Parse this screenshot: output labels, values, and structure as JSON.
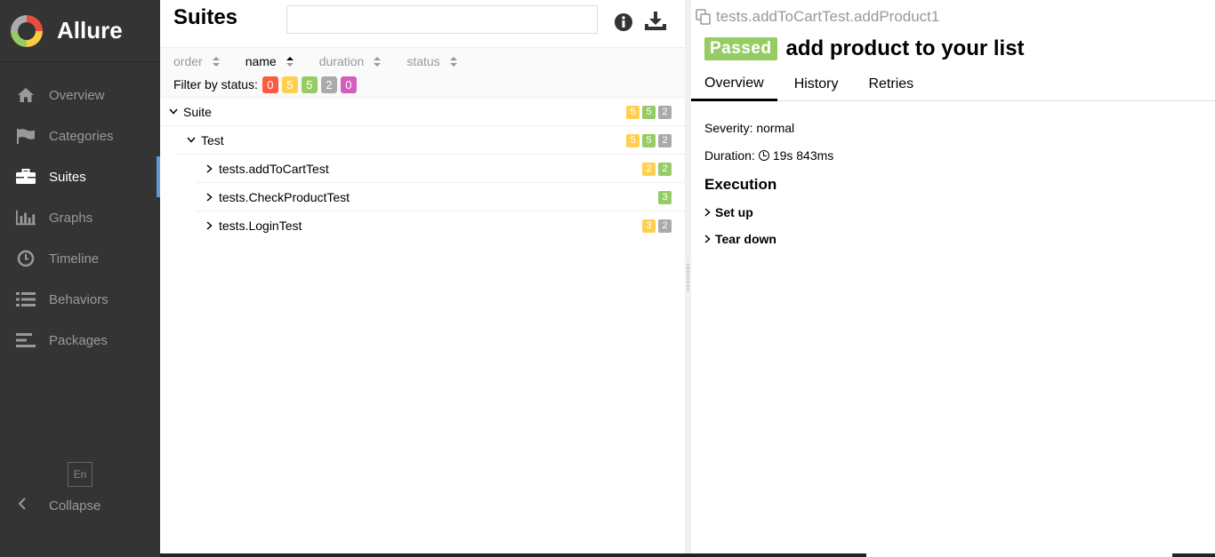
{
  "sidebar": {
    "brand": "Allure",
    "items": [
      {
        "label": "Overview"
      },
      {
        "label": "Categories"
      },
      {
        "label": "Suites"
      },
      {
        "label": "Graphs"
      },
      {
        "label": "Timeline"
      },
      {
        "label": "Behaviors"
      },
      {
        "label": "Packages"
      }
    ],
    "language": "En",
    "collapse_label": "Collapse"
  },
  "middle": {
    "title": "Suites",
    "search": {
      "value": "",
      "placeholder": ""
    },
    "sorters": [
      {
        "label": "order"
      },
      {
        "label": "name"
      },
      {
        "label": "duration"
      },
      {
        "label": "status"
      }
    ],
    "filter_label": "Filter by status:",
    "filter_counts": {
      "failed": "0",
      "broken": "5",
      "passed": "5",
      "skipped": "2",
      "unknown": "0"
    },
    "tree": [
      {
        "label": "Suite",
        "counts": {
          "broken": "5",
          "passed": "5",
          "skipped": "2"
        }
      },
      {
        "label": "Test",
        "counts": {
          "broken": "5",
          "passed": "5",
          "skipped": "2"
        }
      },
      {
        "label": "tests.addToCartTest",
        "counts": {
          "broken": "2",
          "passed": "2"
        }
      },
      {
        "label": "tests.CheckProductTest",
        "counts": {
          "passed": "3"
        }
      },
      {
        "label": "tests.LoginTest",
        "counts": {
          "broken": "3",
          "skipped": "2"
        }
      }
    ]
  },
  "detail": {
    "path": "tests.addToCartTest.addProduct1",
    "status": "Passed",
    "title": "add product to your list",
    "tabs": [
      {
        "label": "Overview"
      },
      {
        "label": "History"
      },
      {
        "label": "Retries"
      }
    ],
    "severity_text": "Severity: normal",
    "duration_label": "Duration:",
    "duration_value": "19s 843ms",
    "execution_title": "Execution",
    "steps": [
      {
        "label": "Set up"
      },
      {
        "label": "Tear down"
      }
    ]
  },
  "colors": {
    "sidebar_bg": "#343434",
    "active_accent": "#5d9cd4",
    "failed": "#fd5a3e",
    "broken": "#ffd050",
    "passed": "#97cc64",
    "skipped": "#aaaaaa",
    "unknown": "#d35ebe"
  },
  "icons": {
    "overview": "home-icon",
    "categories": "flag-icon",
    "suites": "briefcase-icon",
    "graphs": "bar-chart-icon",
    "timeline": "clock-icon",
    "behaviors": "list-icon",
    "packages": "align-left-icon"
  }
}
